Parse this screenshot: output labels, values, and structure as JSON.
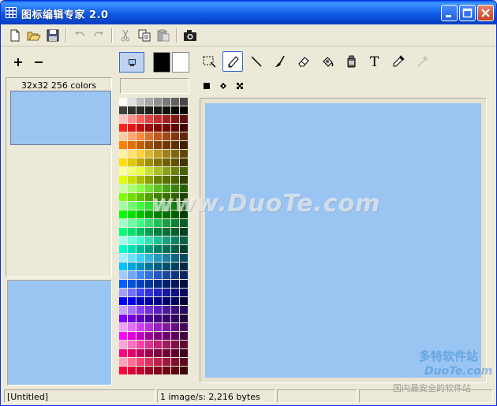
{
  "window": {
    "title": "图标编辑专家  2.0"
  },
  "toolbar": {
    "icons": [
      "new-file-icon",
      "open-folder-icon",
      "save-icon",
      "undo-icon",
      "redo-icon",
      "cut-icon",
      "copy-icon",
      "paste-icon",
      "camera-icon"
    ]
  },
  "left_panel": {
    "info_label": "32x32 256 colors"
  },
  "colors": {
    "icon_fill": "#9ac5f2",
    "foreground": "#000000",
    "background": "#ffffff",
    "title_blue": "#0a5bf0"
  },
  "palette": [
    "#ffffff",
    "#e0e0e0",
    "#c0c0c0",
    "#a8a8a8",
    "#909090",
    "#787878",
    "#606060",
    "#484848",
    "#404040",
    "#303030",
    "#282828",
    "#202020",
    "#181818",
    "#101010",
    "#080808",
    "#000000",
    "#ffc0c0",
    "#ff9090",
    "#ff6060",
    "#e04040",
    "#c03030",
    "#a02020",
    "#801818",
    "#601010",
    "#ff2020",
    "#e01818",
    "#c01010",
    "#a00c0c",
    "#800808",
    "#700606",
    "#600404",
    "#400000",
    "#ffc8a0",
    "#ffa870",
    "#ff8840",
    "#e07030",
    "#c05820",
    "#a04818",
    "#803810",
    "#602808",
    "#ff8000",
    "#e07000",
    "#c06000",
    "#a05000",
    "#804000",
    "#703800",
    "#603000",
    "#402000",
    "#fff0a0",
    "#ffe070",
    "#ffd040",
    "#e0b830",
    "#c09820",
    "#a08018",
    "#806410",
    "#604808",
    "#ffe000",
    "#e0c800",
    "#c0a800",
    "#a08c00",
    "#807000",
    "#706000",
    "#605000",
    "#403400",
    "#f8ffa0",
    "#f0ff70",
    "#e8ff40",
    "#c8e030",
    "#a8c020",
    "#88a018",
    "#688010",
    "#486008",
    "#e0ff00",
    "#c8e000",
    "#a8c000",
    "#88a000",
    "#688000",
    "#587000",
    "#486000",
    "#304000",
    "#c8ffa0",
    "#a8ff70",
    "#88ff40",
    "#70e030",
    "#58c020",
    "#48a018",
    "#388010",
    "#286008",
    "#80ff00",
    "#70e000",
    "#60c000",
    "#50a000",
    "#408000",
    "#387000",
    "#306000",
    "#204000",
    "#a0ffa0",
    "#70ff70",
    "#40ff40",
    "#30e030",
    "#20c020",
    "#18a018",
    "#108010",
    "#086008",
    "#00ff00",
    "#00e000",
    "#00c000",
    "#00a000",
    "#008000",
    "#007000",
    "#006000",
    "#004000",
    "#a0ffc8",
    "#70ffa8",
    "#40ff88",
    "#30e070",
    "#20c058",
    "#18a048",
    "#108038",
    "#086028",
    "#00ff80",
    "#00e070",
    "#00c060",
    "#00a050",
    "#008040",
    "#007038",
    "#006030",
    "#004020",
    "#a0fff0",
    "#70ffe0",
    "#40ffd0",
    "#30e0b8",
    "#20c098",
    "#18a080",
    "#108064",
    "#086048",
    "#00ffd0",
    "#00e0b8",
    "#00c098",
    "#00a080",
    "#008064",
    "#007058",
    "#006048",
    "#004030",
    "#a0f0ff",
    "#70e0ff",
    "#40d0ff",
    "#30b8e0",
    "#2098c0",
    "#1880a0",
    "#106480",
    "#084860",
    "#00c0ff",
    "#00a8e0",
    "#0090c0",
    "#0078a0",
    "#006080",
    "#005070",
    "#004060",
    "#002840",
    "#a0c8ff",
    "#70a8ff",
    "#4088ff",
    "#3070e0",
    "#2058c0",
    "#1848a0",
    "#103880",
    "#082860",
    "#0060ff",
    "#0050e0",
    "#0040c0",
    "#0034a0",
    "#002880",
    "#002070",
    "#001860",
    "#001040",
    "#a0a0ff",
    "#7070ff",
    "#4040ff",
    "#3030e0",
    "#2020c0",
    "#1818a0",
    "#101080",
    "#080860",
    "#0000ff",
    "#0000e0",
    "#0000c0",
    "#0000a0",
    "#000080",
    "#000070",
    "#000060",
    "#000040",
    "#c8a0ff",
    "#a870ff",
    "#8840ff",
    "#7030e0",
    "#5820c0",
    "#4818a0",
    "#381080",
    "#280860",
    "#8000ff",
    "#7000e0",
    "#6000c0",
    "#5000a0",
    "#400080",
    "#380070",
    "#300060",
    "#200040",
    "#f0a0ff",
    "#e070ff",
    "#d040ff",
    "#b830e0",
    "#9820c0",
    "#8018a0",
    "#641080",
    "#480860",
    "#ff00ff",
    "#e000e0",
    "#c000c0",
    "#a000a0",
    "#800080",
    "#700070",
    "#600060",
    "#400040",
    "#ffa0d8",
    "#ff70c0",
    "#ff40a8",
    "#e03090",
    "#c02078",
    "#a01860",
    "#801048",
    "#600830",
    "#ff0080",
    "#e00070",
    "#c00060",
    "#a00050",
    "#800040",
    "#700038",
    "#600030",
    "#400020",
    "#ffa0b8",
    "#ff7098",
    "#ff4078",
    "#e03060",
    "#c02050",
    "#a01840",
    "#801030",
    "#600820",
    "#ff0040",
    "#e00038",
    "#c00030",
    "#a00028",
    "#800020",
    "#700018",
    "#600010",
    "#400008"
  ],
  "tools": [
    {
      "name": "select-tool",
      "icon": "marquee-select-icon",
      "active": false
    },
    {
      "name": "pencil-tool",
      "icon": "pencil-icon",
      "active": true
    },
    {
      "name": "line-tool",
      "icon": "line-icon",
      "active": false
    },
    {
      "name": "brush-tool",
      "icon": "brush-icon",
      "active": false
    },
    {
      "name": "eraser-tool",
      "icon": "eraser-icon",
      "active": false
    },
    {
      "name": "fill-tool",
      "icon": "paint-bucket-icon",
      "active": false
    },
    {
      "name": "spray-tool",
      "icon": "spray-can-icon",
      "active": false
    },
    {
      "name": "text-tool",
      "icon": "text-icon",
      "active": false
    },
    {
      "name": "color-picker-tool",
      "icon": "eyedropper-icon",
      "active": false
    },
    {
      "name": "magic-tool",
      "icon": "magic-wand-icon",
      "active": false
    }
  ],
  "brush_sizes": [
    "square-brush-icon",
    "diamond-brush-icon",
    "cross-brush-icon"
  ],
  "text_tool_glyph": "T",
  "watermark": {
    "main": "www.DuoTe.com",
    "logo": "多特软件站",
    "logo_domain": "DuoTe.com",
    "slogan": "国内最安全的软件站"
  },
  "statusbar": {
    "file": "[Untitled]",
    "info": "1 image/s: 2,216 bytes",
    "panel3": "",
    "panel4": ""
  }
}
